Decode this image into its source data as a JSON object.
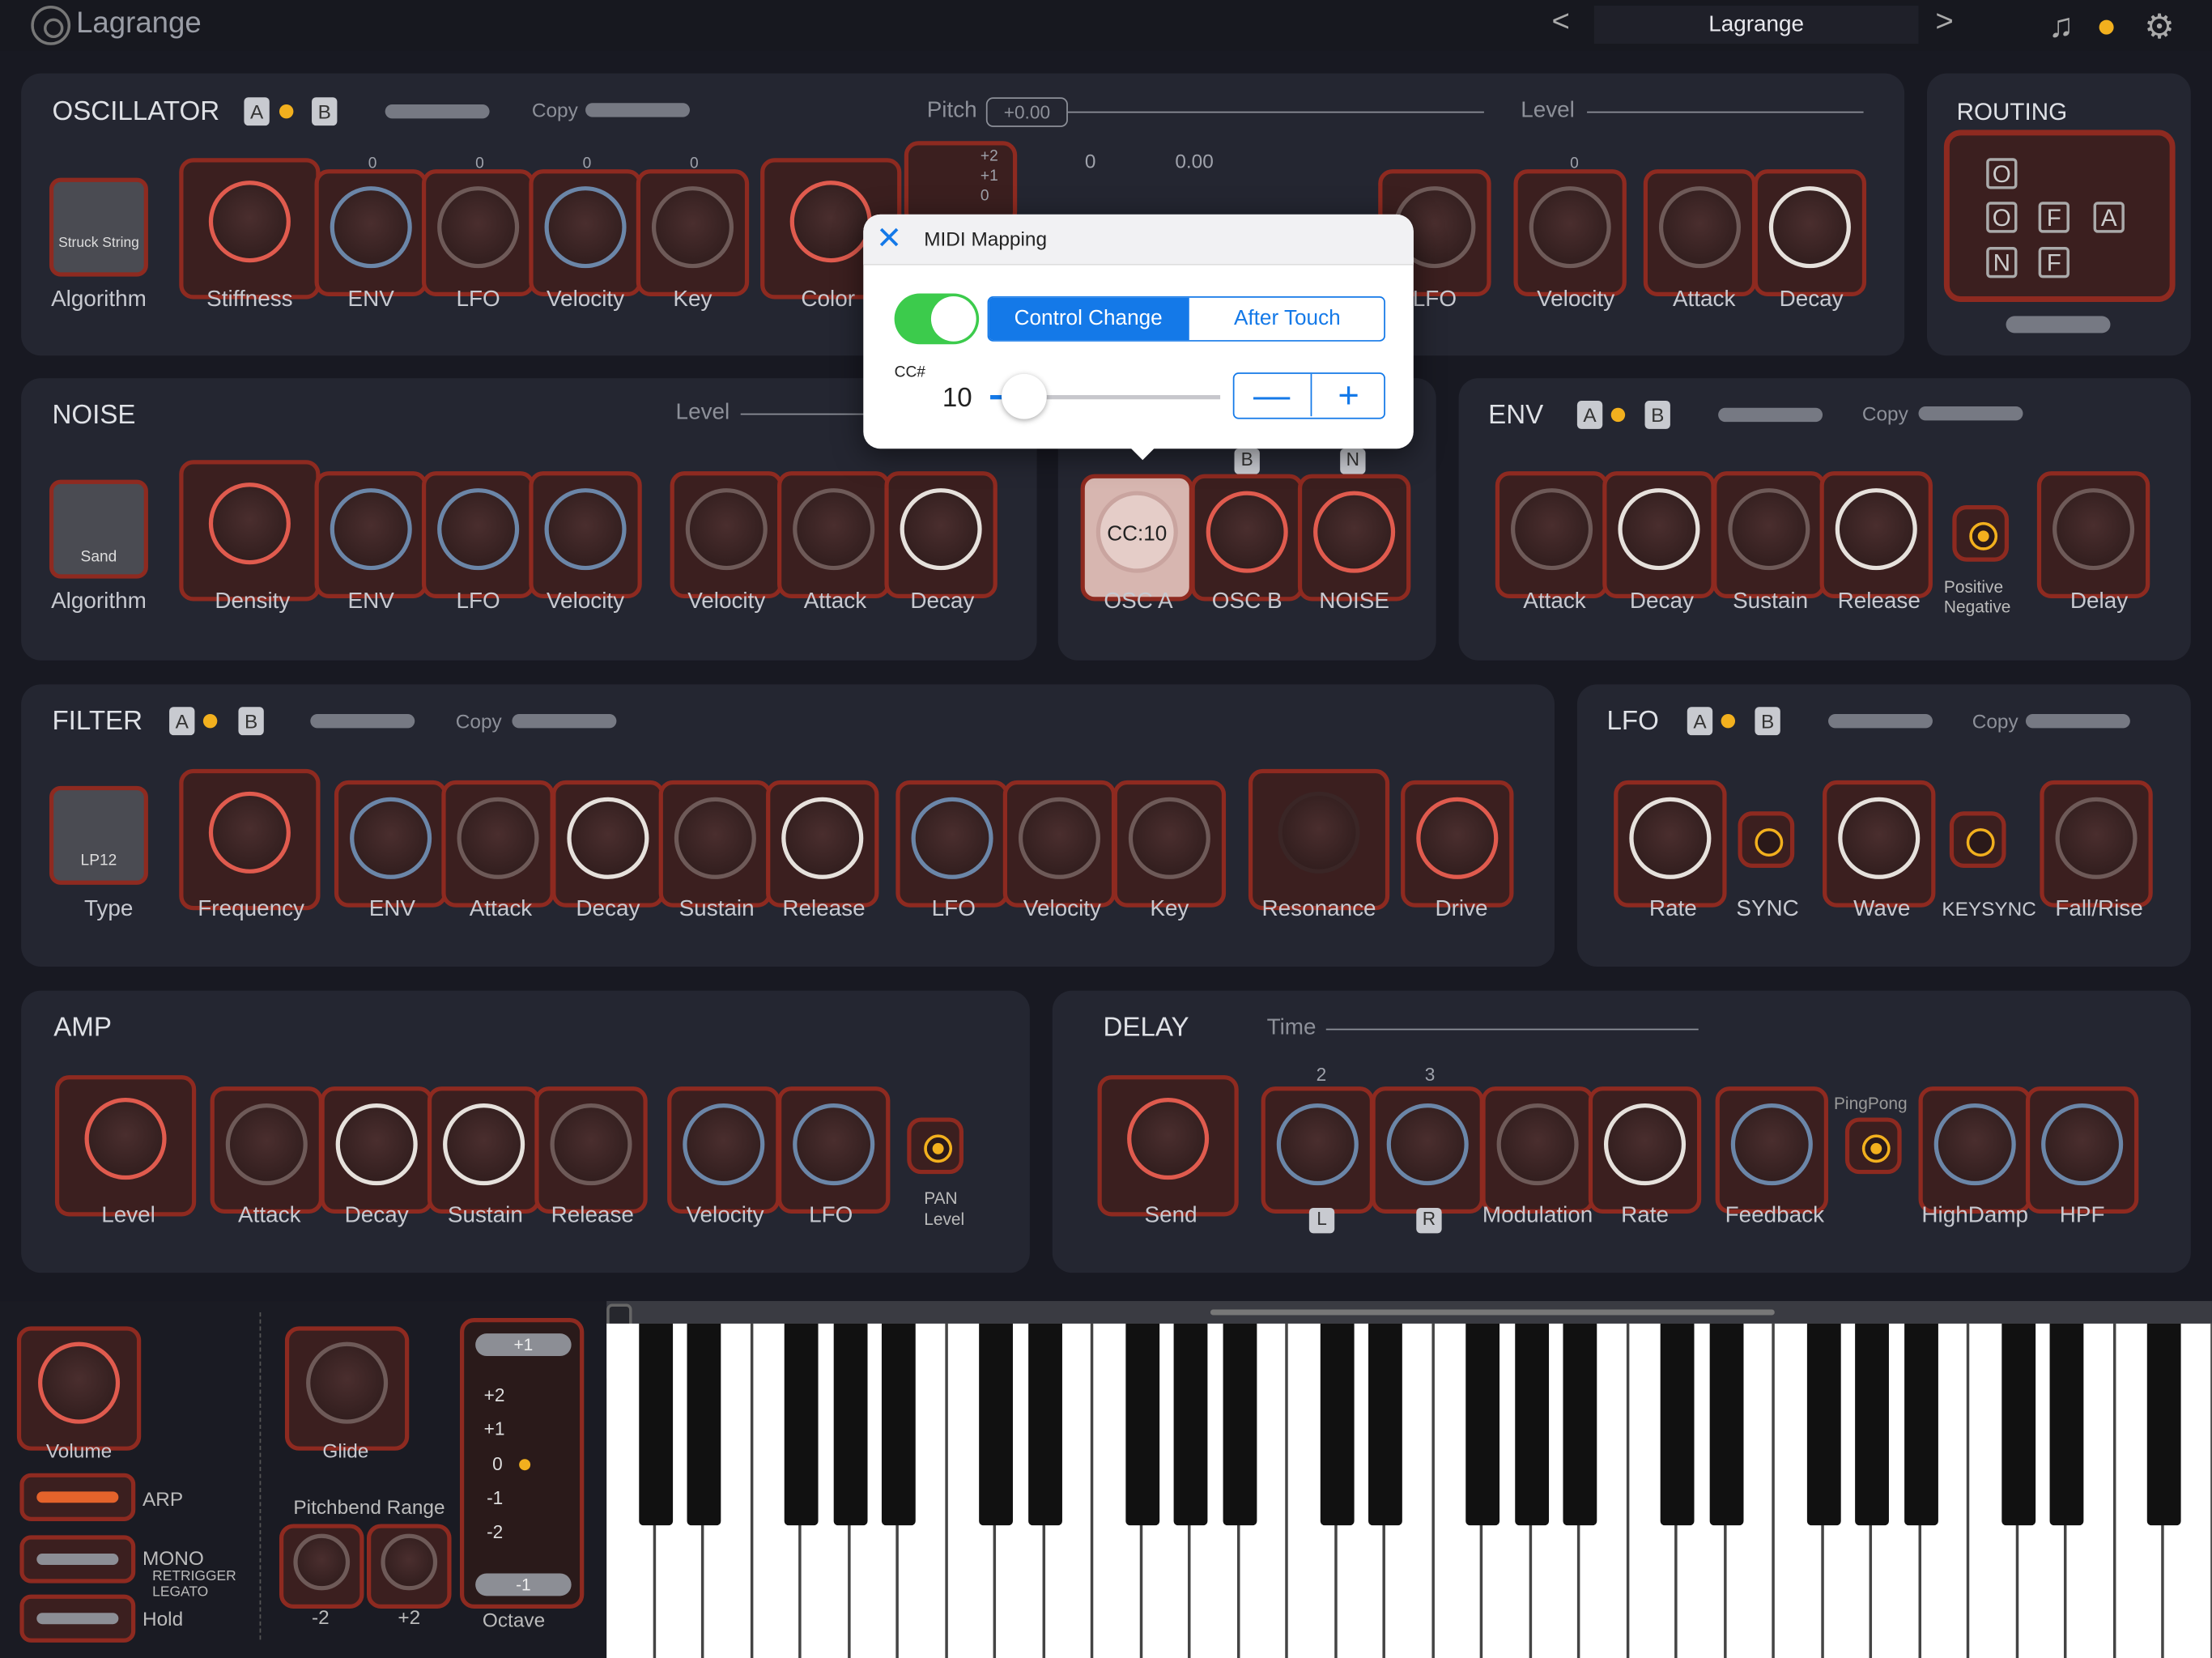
{
  "app": {
    "title": "Lagrange",
    "preset": "Lagrange",
    "prev": "<",
    "next": ">"
  },
  "icons": {
    "logo": "lagrange-logo-icon",
    "music": "music-note-icon",
    "midi": "midi-port-icon",
    "settings": "gear-icon"
  },
  "osc": {
    "title": "OSCILLATOR",
    "a": "A",
    "b": "B",
    "copy": "Copy",
    "pitch": "Pitch",
    "pitch_val": "+0.00",
    "level": "Level",
    "algo_label": "Struck String",
    "algorithm": "Algorithm",
    "knobs": [
      "Stiffness",
      "ENV",
      "LFO",
      "Velocity",
      "Key",
      "Color",
      "LFO",
      "Velocity",
      "Attack",
      "Decay"
    ],
    "zero": "0",
    "fine": "0.00",
    "octave": [
      "+2",
      "+1",
      "0"
    ]
  },
  "routing": {
    "title": "ROUTING",
    "nodes": [
      "O",
      "O",
      "N",
      "F",
      "F",
      "A"
    ]
  },
  "noise": {
    "title": "NOISE",
    "level": "Level",
    "algo_label": "Sand",
    "algorithm": "Algorithm",
    "knobs": [
      "Density",
      "ENV",
      "LFO",
      "Velocity",
      "Velocity",
      "Attack",
      "Decay"
    ]
  },
  "mixer": {
    "knobs": [
      "OSC A",
      "OSC B",
      "NOISE"
    ],
    "badges": [
      "B",
      "N"
    ],
    "cc": "CC:10"
  },
  "env": {
    "title": "ENV",
    "a": "A",
    "b": "B",
    "copy": "Copy",
    "knobs": [
      "Attack",
      "Decay",
      "Sustain",
      "Release",
      "Delay"
    ],
    "positive": "Positive",
    "negative": "Negative"
  },
  "filter": {
    "title": "FILTER",
    "a": "A",
    "b": "B",
    "copy": "Copy",
    "type_label": "LP12",
    "type": "Type",
    "knobs": [
      "Frequency",
      "ENV",
      "Attack",
      "Decay",
      "Sustain",
      "Release",
      "LFO",
      "Velocity",
      "Key",
      "Resonance",
      "Drive"
    ]
  },
  "lfo": {
    "title": "LFO",
    "a": "A",
    "b": "B",
    "copy": "Copy",
    "knobs": [
      "Rate",
      "SYNC",
      "Wave",
      "KEYSYNC",
      "Fall/Rise"
    ]
  },
  "amp": {
    "title": "AMP",
    "knobs": [
      "Level",
      "Attack",
      "Decay",
      "Sustain",
      "Release",
      "Velocity",
      "LFO"
    ],
    "pan": "PAN",
    "level": "Level"
  },
  "delay": {
    "title": "DELAY",
    "time": "Time",
    "knobs": [
      "Send",
      "Modulation",
      "Rate",
      "Feedback",
      "HighDamp",
      "HPF"
    ],
    "pingpong": "PingPong",
    "l": "L",
    "r": "R",
    "t2": "2",
    "t3": "3"
  },
  "dialog": {
    "title": "MIDI Mapping",
    "close": "✕",
    "control_change": "Control Change",
    "after_touch": "After Touch",
    "cc_label": "CC#",
    "cc_value": "10",
    "minus": "—",
    "plus": "+",
    "cc_fraction": 0.08
  },
  "bottom": {
    "volume": "Volume",
    "arp": "ARP",
    "mono": "MONO",
    "retrigger": "RETRIGGER",
    "legato": "LEGATO",
    "hold": "Hold",
    "glide": "Glide",
    "pitchbend": "Pitchbend Range",
    "pb_minus": "-2",
    "pb_plus": "+2",
    "octave": "Octave",
    "oct_top": "+1",
    "oct_bottom": "-1",
    "oct_list": [
      "+2",
      "+1",
      "0",
      "-1",
      "-2"
    ]
  }
}
